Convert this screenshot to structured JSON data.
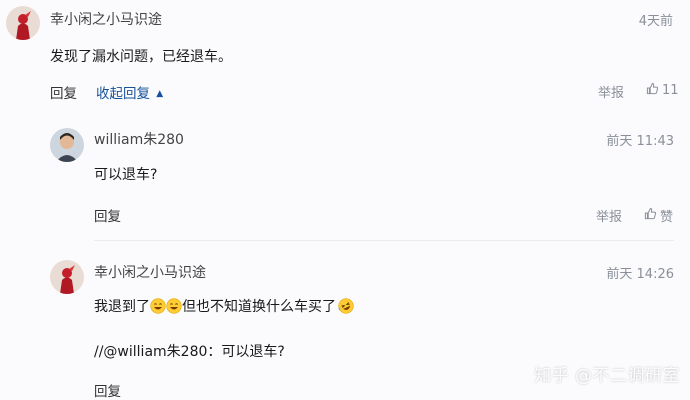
{
  "comments": [
    {
      "author": "幸小闲之小马识途",
      "time": "4天前",
      "text": "发现了漏水问题，已经退车。",
      "reply_label": "回复",
      "collapse_label": "收起回复",
      "report_label": "举报",
      "likes": "11"
    },
    {
      "author": "william朱280",
      "time": "前天 11:43",
      "text": "可以退车?",
      "reply_label": "回复",
      "report_label": "举报",
      "like_label": "赞"
    },
    {
      "author": "幸小闲之小马识途",
      "time": "前天 14:26",
      "text_part1": "我退到了",
      "text_part2": "但也不知道换什么车买了",
      "quote": "//@william朱280：可以退车?",
      "reply_label": "回复"
    }
  ],
  "watermark": "知乎 @不二调研室",
  "icons": {
    "like": "thumbs-up-icon",
    "collapse": "caret-up-icon",
    "emoji_happy": "grinning-face-emoji",
    "emoji_laugh": "rolling-laughing-emoji"
  },
  "colors": {
    "link_blue": "#175199",
    "muted": "#8a8f99"
  }
}
